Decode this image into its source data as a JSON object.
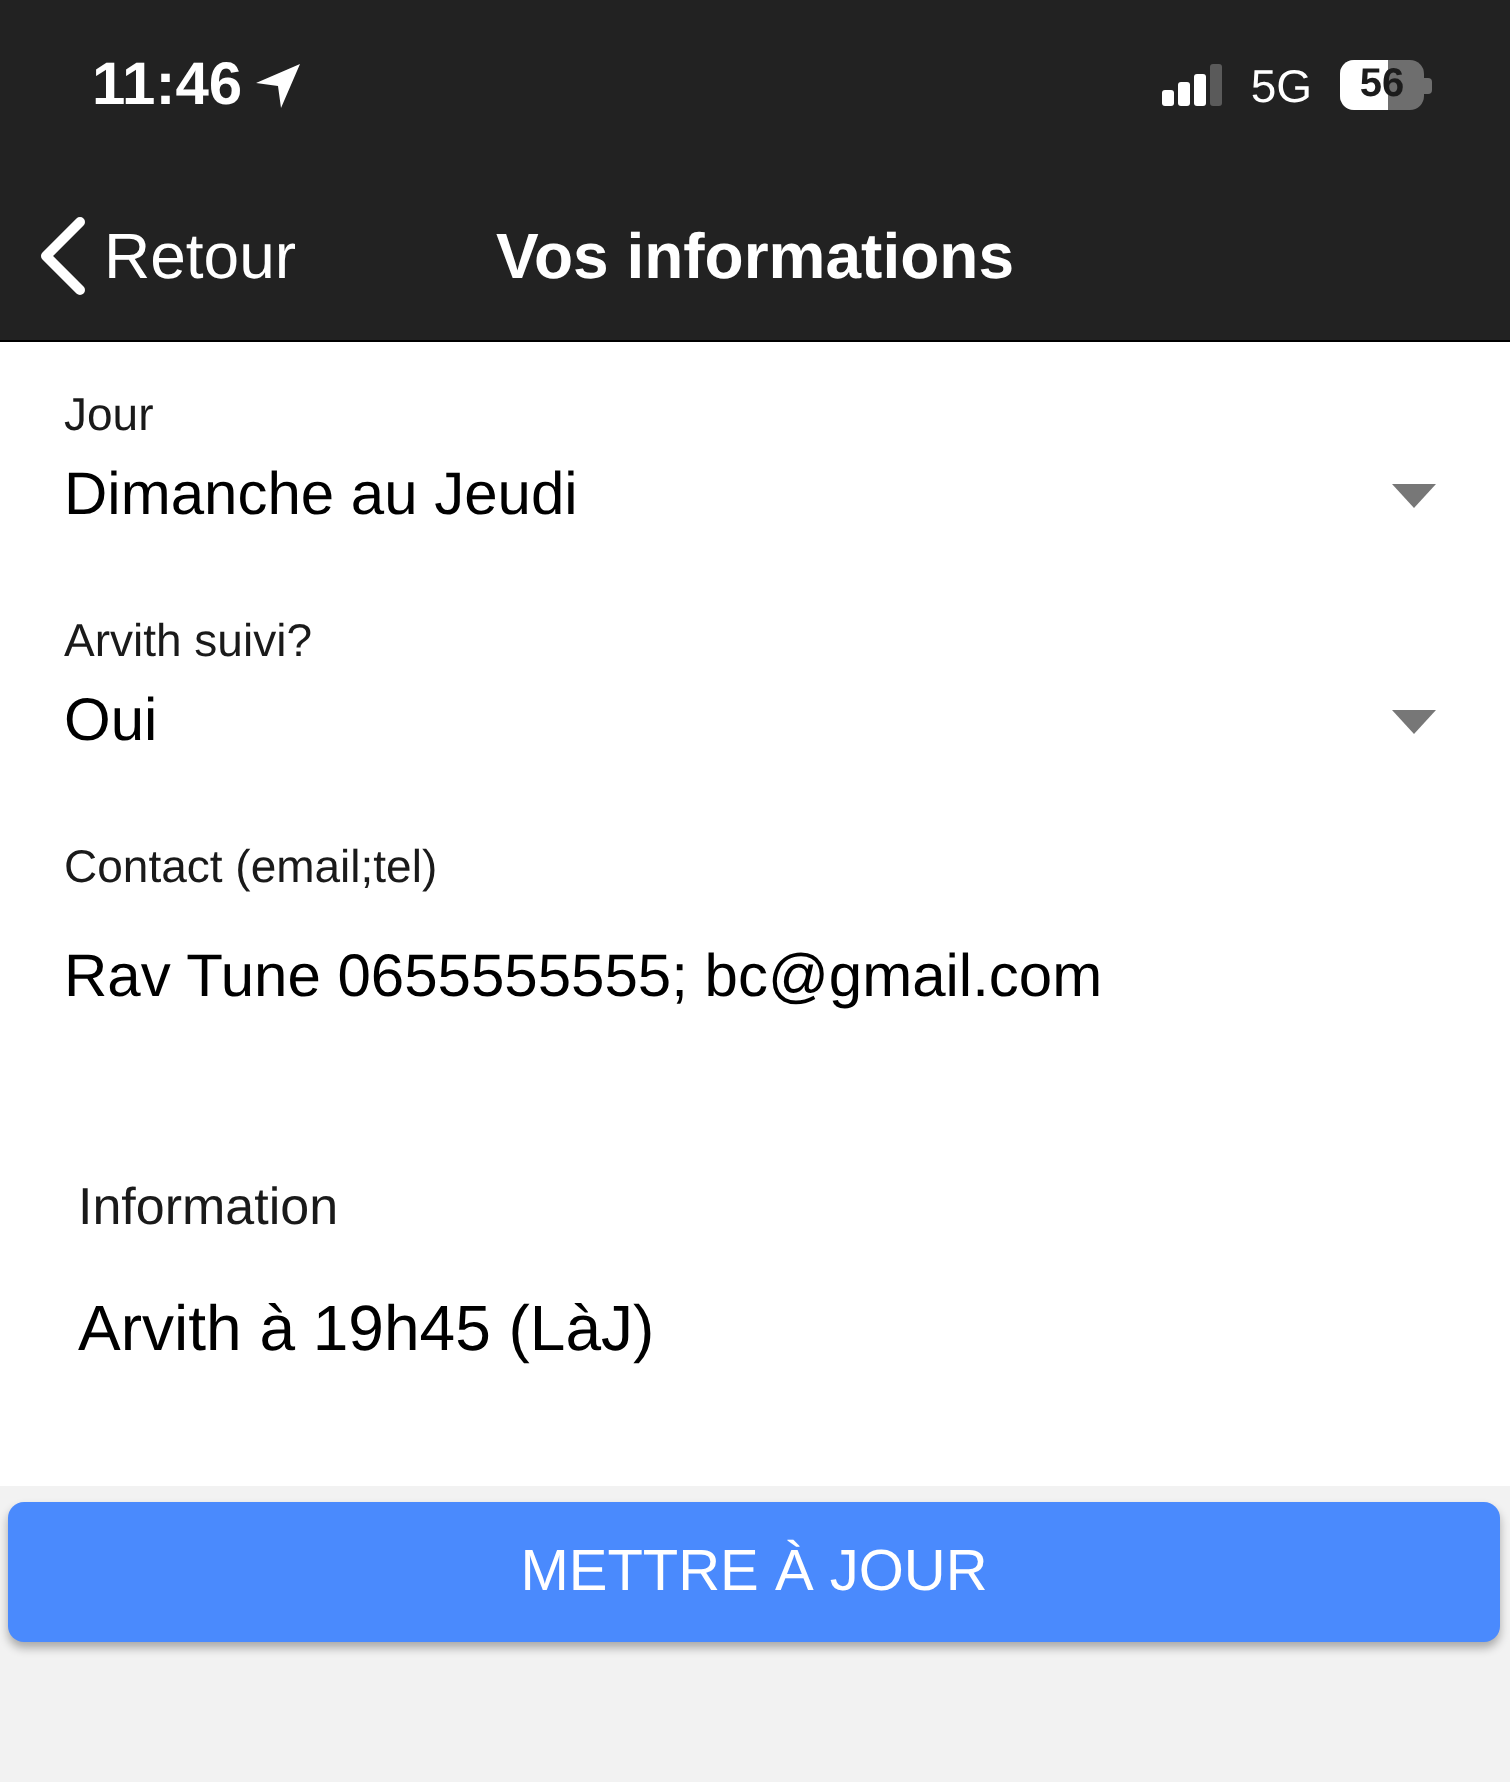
{
  "status_bar": {
    "time": "11:46",
    "network": "5G",
    "battery": "56"
  },
  "nav_bar": {
    "back_label": "Retour",
    "title": "Vos informations"
  },
  "fields": [
    {
      "kind": "select",
      "label": "Jour",
      "value": "Dimanche au Jeudi"
    },
    {
      "kind": "select",
      "label": "Arvith suivi?",
      "value": "Oui"
    },
    {
      "kind": "text",
      "label": "Contact (email;tel)",
      "value": "Rav Tune 0655555555; bc@gmail.com"
    },
    {
      "kind": "textarea",
      "label": "Information",
      "value": "Arvith à 19h45 (LàJ)"
    }
  ],
  "update_button": {
    "label": "METTRE À JOUR"
  }
}
